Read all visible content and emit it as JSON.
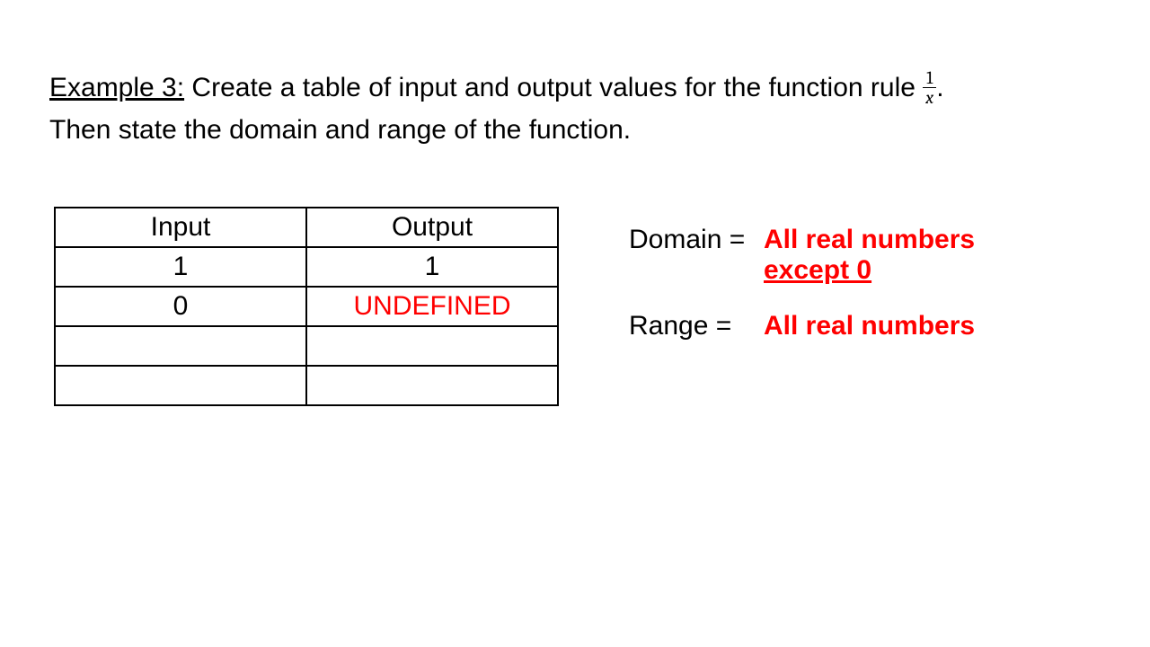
{
  "prompt": {
    "example_label": "Example 3:",
    "text_before_fraction": " Create a table of input and output values for the function rule ",
    "fraction_num": "1",
    "fraction_den": "x",
    "period": ".",
    "line2": "Then state the domain and range of the function."
  },
  "table": {
    "headers": {
      "input": "Input",
      "output": "Output"
    },
    "rows": [
      {
        "input": "1",
        "output": "1",
        "out_red": false
      },
      {
        "input": "0",
        "output": "UNDEFINED",
        "out_red": true
      },
      {
        "input": "",
        "output": "",
        "out_red": false
      },
      {
        "input": "",
        "output": "",
        "out_red": false
      }
    ]
  },
  "answers": {
    "domain_label": "Domain =",
    "domain_value_line1": "All real numbers",
    "domain_value_line2": "except 0",
    "range_label": "Range =",
    "range_value": "All real numbers"
  },
  "chart_data": {
    "type": "table",
    "columns": [
      "Input",
      "Output"
    ],
    "rows": [
      [
        "1",
        "1"
      ],
      [
        "0",
        "UNDEFINED"
      ],
      [
        "",
        ""
      ],
      [
        "",
        ""
      ]
    ],
    "function_rule": "1/x",
    "domain": "All real numbers except 0",
    "range": "All real numbers"
  }
}
